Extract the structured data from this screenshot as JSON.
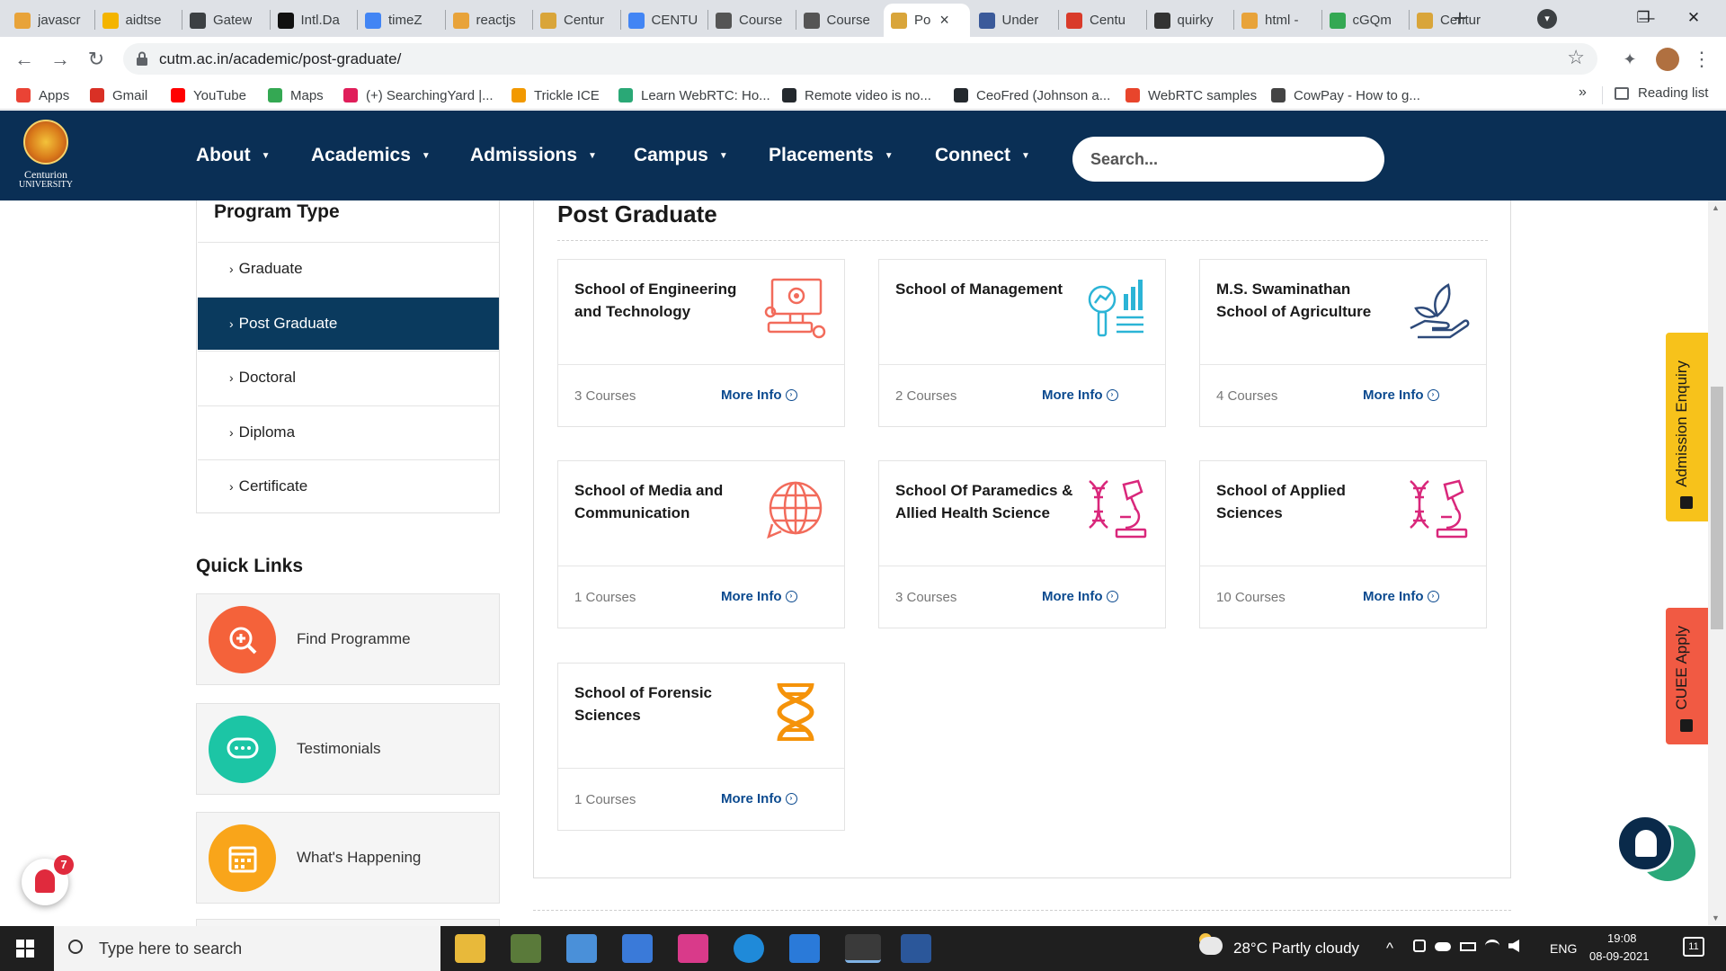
{
  "browser": {
    "tabs": [
      {
        "label": "javascr",
        "color": "#e8a33a"
      },
      {
        "label": "aidtse",
        "color": "#f4b400"
      },
      {
        "label": "Gatew",
        "color": "#3c4043"
      },
      {
        "label": "Intl.Da",
        "color": "#111111"
      },
      {
        "label": "timeZ",
        "color": "#4285f4"
      },
      {
        "label": "reactjs",
        "color": "#e8a33a"
      },
      {
        "label": "Centur",
        "color": "#d9a53a"
      },
      {
        "label": "CENTU",
        "color": "#4285f4"
      },
      {
        "label": "Course",
        "color": "#555555"
      },
      {
        "label": "Course",
        "color": "#555555"
      },
      {
        "label": "Po",
        "color": "#d9a53a",
        "active": true
      },
      {
        "label": "Under",
        "color": "#3b5a9a"
      },
      {
        "label": "Centu",
        "color": "#d93b2a"
      },
      {
        "label": "quirky",
        "color": "#333333"
      },
      {
        "label": "html -",
        "color": "#e8a33a"
      },
      {
        "label": "cGQm",
        "color": "#34a853"
      },
      {
        "label": "Centur",
        "color": "#d9a53a"
      }
    ],
    "new_tab": "+",
    "tab_search": "▾",
    "window": {
      "minimize": "—",
      "maximize": "❐",
      "close": "✕"
    },
    "url": "cutm.ac.in/academic/post-graduate/",
    "back": "←",
    "forward": "→",
    "reload": "↻",
    "star": "☆",
    "extensions": "✦",
    "menu": "⋮",
    "bookmarks": [
      {
        "label": "Apps",
        "color": "#ea4335"
      },
      {
        "label": "Gmail",
        "color": "#d93025"
      },
      {
        "label": "YouTube",
        "color": "#ff0000"
      },
      {
        "label": "Maps",
        "color": "#34a853"
      },
      {
        "label": "(+) SearchingYard |...",
        "color": "#e01e5a"
      },
      {
        "label": "Trickle ICE",
        "color": "#f29900"
      },
      {
        "label": "Learn WebRTC: Ho...",
        "color": "#2aa876"
      },
      {
        "label": "Remote video is no...",
        "color": "#24292e"
      },
      {
        "label": "CeoFred (Johnson a...",
        "color": "#24292e"
      },
      {
        "label": "WebRTC samples",
        "color": "#e8452c"
      },
      {
        "label": "CowPay - How to g...",
        "color": "#444444"
      }
    ],
    "more_bookmarks": "»",
    "reading_list": "Reading list"
  },
  "site": {
    "logo_text_1": "Centurion",
    "logo_text_2": "UNIVERSITY",
    "nav": [
      "About",
      "Academics",
      "Admissions",
      "Campus",
      "Placements",
      "Connect"
    ],
    "nav_caret": "▼",
    "search_placeholder": "Search..."
  },
  "sidebar": {
    "program_title": "Program Type",
    "program_items": [
      {
        "label": "Graduate"
      },
      {
        "label": "Post Graduate",
        "active": true
      },
      {
        "label": "Doctoral"
      },
      {
        "label": "Diploma"
      },
      {
        "label": "Certificate"
      }
    ],
    "chevron": "›",
    "quick_title": "Quick Links",
    "quick_links": [
      {
        "label": "Find Programme",
        "color": "#f4623a"
      },
      {
        "label": "Testimonials",
        "color": "#1cc5a5"
      },
      {
        "label": "What's Happening",
        "color": "#f9a51a"
      }
    ]
  },
  "main": {
    "title": "Post Graduate",
    "more_label": "More Info",
    "more_arrow": "›",
    "cards": [
      {
        "name": "School of Engineering and Technology",
        "count": "3 Courses",
        "icon": "computer-gear-icon",
        "color": "#f26b5b"
      },
      {
        "name": "School of Management",
        "count": "2 Courses",
        "icon": "analytics-magnifier-icon",
        "color": "#2bb4d6"
      },
      {
        "name": "M.S. Swaminathan School of Agriculture",
        "count": "4 Courses",
        "icon": "plant-hand-icon",
        "color": "#2d4a7a"
      },
      {
        "name": "School of Media and Communication",
        "count": "1 Courses",
        "icon": "globe-chat-icon",
        "color": "#f26b5b"
      },
      {
        "name": "School Of Paramedics & Allied Health Science",
        "count": "3 Courses",
        "icon": "dna-microscope-icon",
        "color": "#d9277b"
      },
      {
        "name": "School of Applied Sciences",
        "count": "10 Courses",
        "icon": "dna-microscope-icon",
        "color": "#d9277b"
      },
      {
        "name": "School of Forensic Sciences",
        "count": "1 Courses",
        "icon": "dna-icon",
        "color": "#f5930a"
      }
    ]
  },
  "side_tabs": {
    "enquiry": "Admission Enquiry",
    "enquiry_color": "#f7c21b",
    "apply": "CUEE Apply",
    "apply_color": "#f15a43"
  },
  "notifications": {
    "count": "7"
  },
  "taskbar": {
    "search_placeholder": "Type here to search",
    "weather": "28°C  Partly cloudy",
    "lang": "ENG",
    "time": "19:08",
    "date": "08-09-2021",
    "notif_count": "11",
    "tray_up": "^"
  }
}
